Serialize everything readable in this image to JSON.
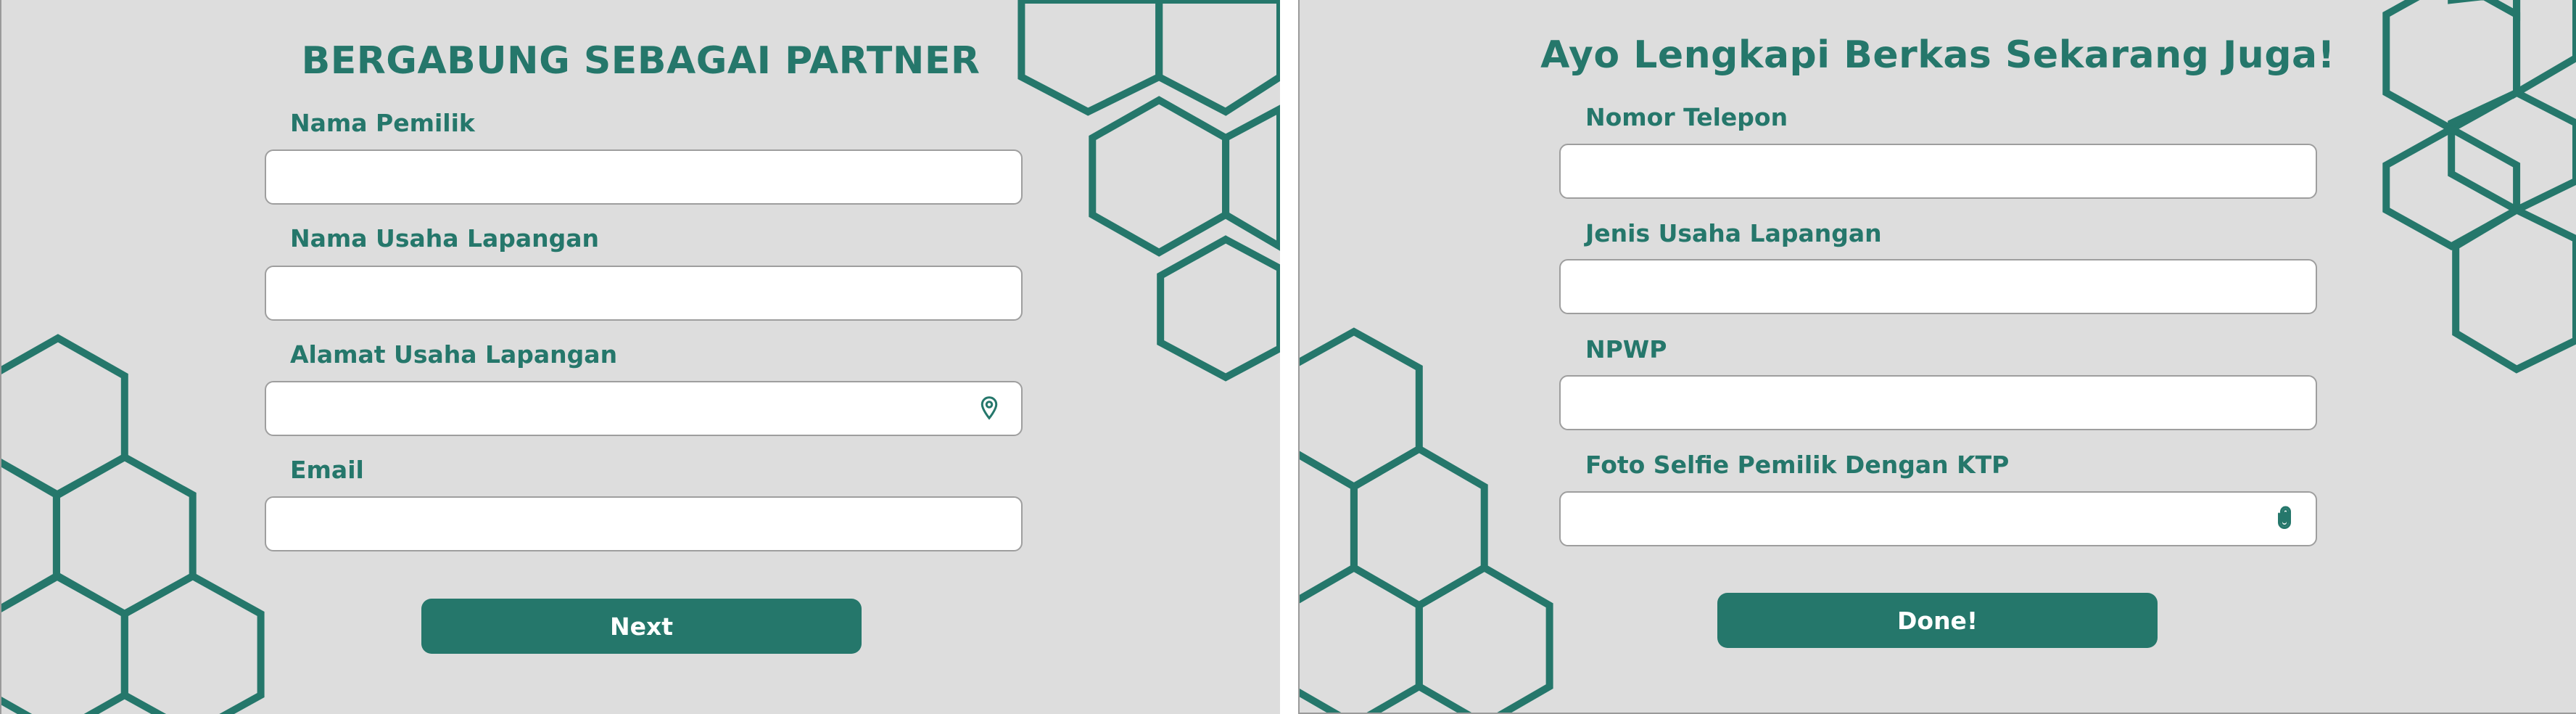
{
  "left_form": {
    "title": "BERGABUNG SEBAGAI PARTNER",
    "fields": [
      {
        "label": "Nama Pemilik",
        "value": "",
        "placeholder": ""
      },
      {
        "label": "Nama Usaha Lapangan",
        "value": "",
        "placeholder": ""
      },
      {
        "label": "Alamat Usaha Lapangan",
        "value": "",
        "placeholder": "",
        "icon": "location-pin-icon"
      },
      {
        "label": "Email",
        "value": "",
        "placeholder": ""
      }
    ],
    "submit_label": "Next"
  },
  "right_form": {
    "title": "Ayo Lengkapi Berkas Sekarang Juga!",
    "fields": [
      {
        "label": "Nomor Telepon",
        "value": "",
        "placeholder": ""
      },
      {
        "label": "Jenis Usaha Lapangan",
        "value": "",
        "placeholder": ""
      },
      {
        "label": "NPWP",
        "value": "",
        "placeholder": ""
      },
      {
        "label": "Foto Selfie Pemilik Dengan KTP",
        "value": "",
        "placeholder": "",
        "icon": "paperclip-icon"
      }
    ],
    "submit_label": "Done!"
  },
  "colors": {
    "accent": "#25776b",
    "background": "#dddddd",
    "input_background": "#ffffff",
    "input_border": "#9e9e9e"
  }
}
